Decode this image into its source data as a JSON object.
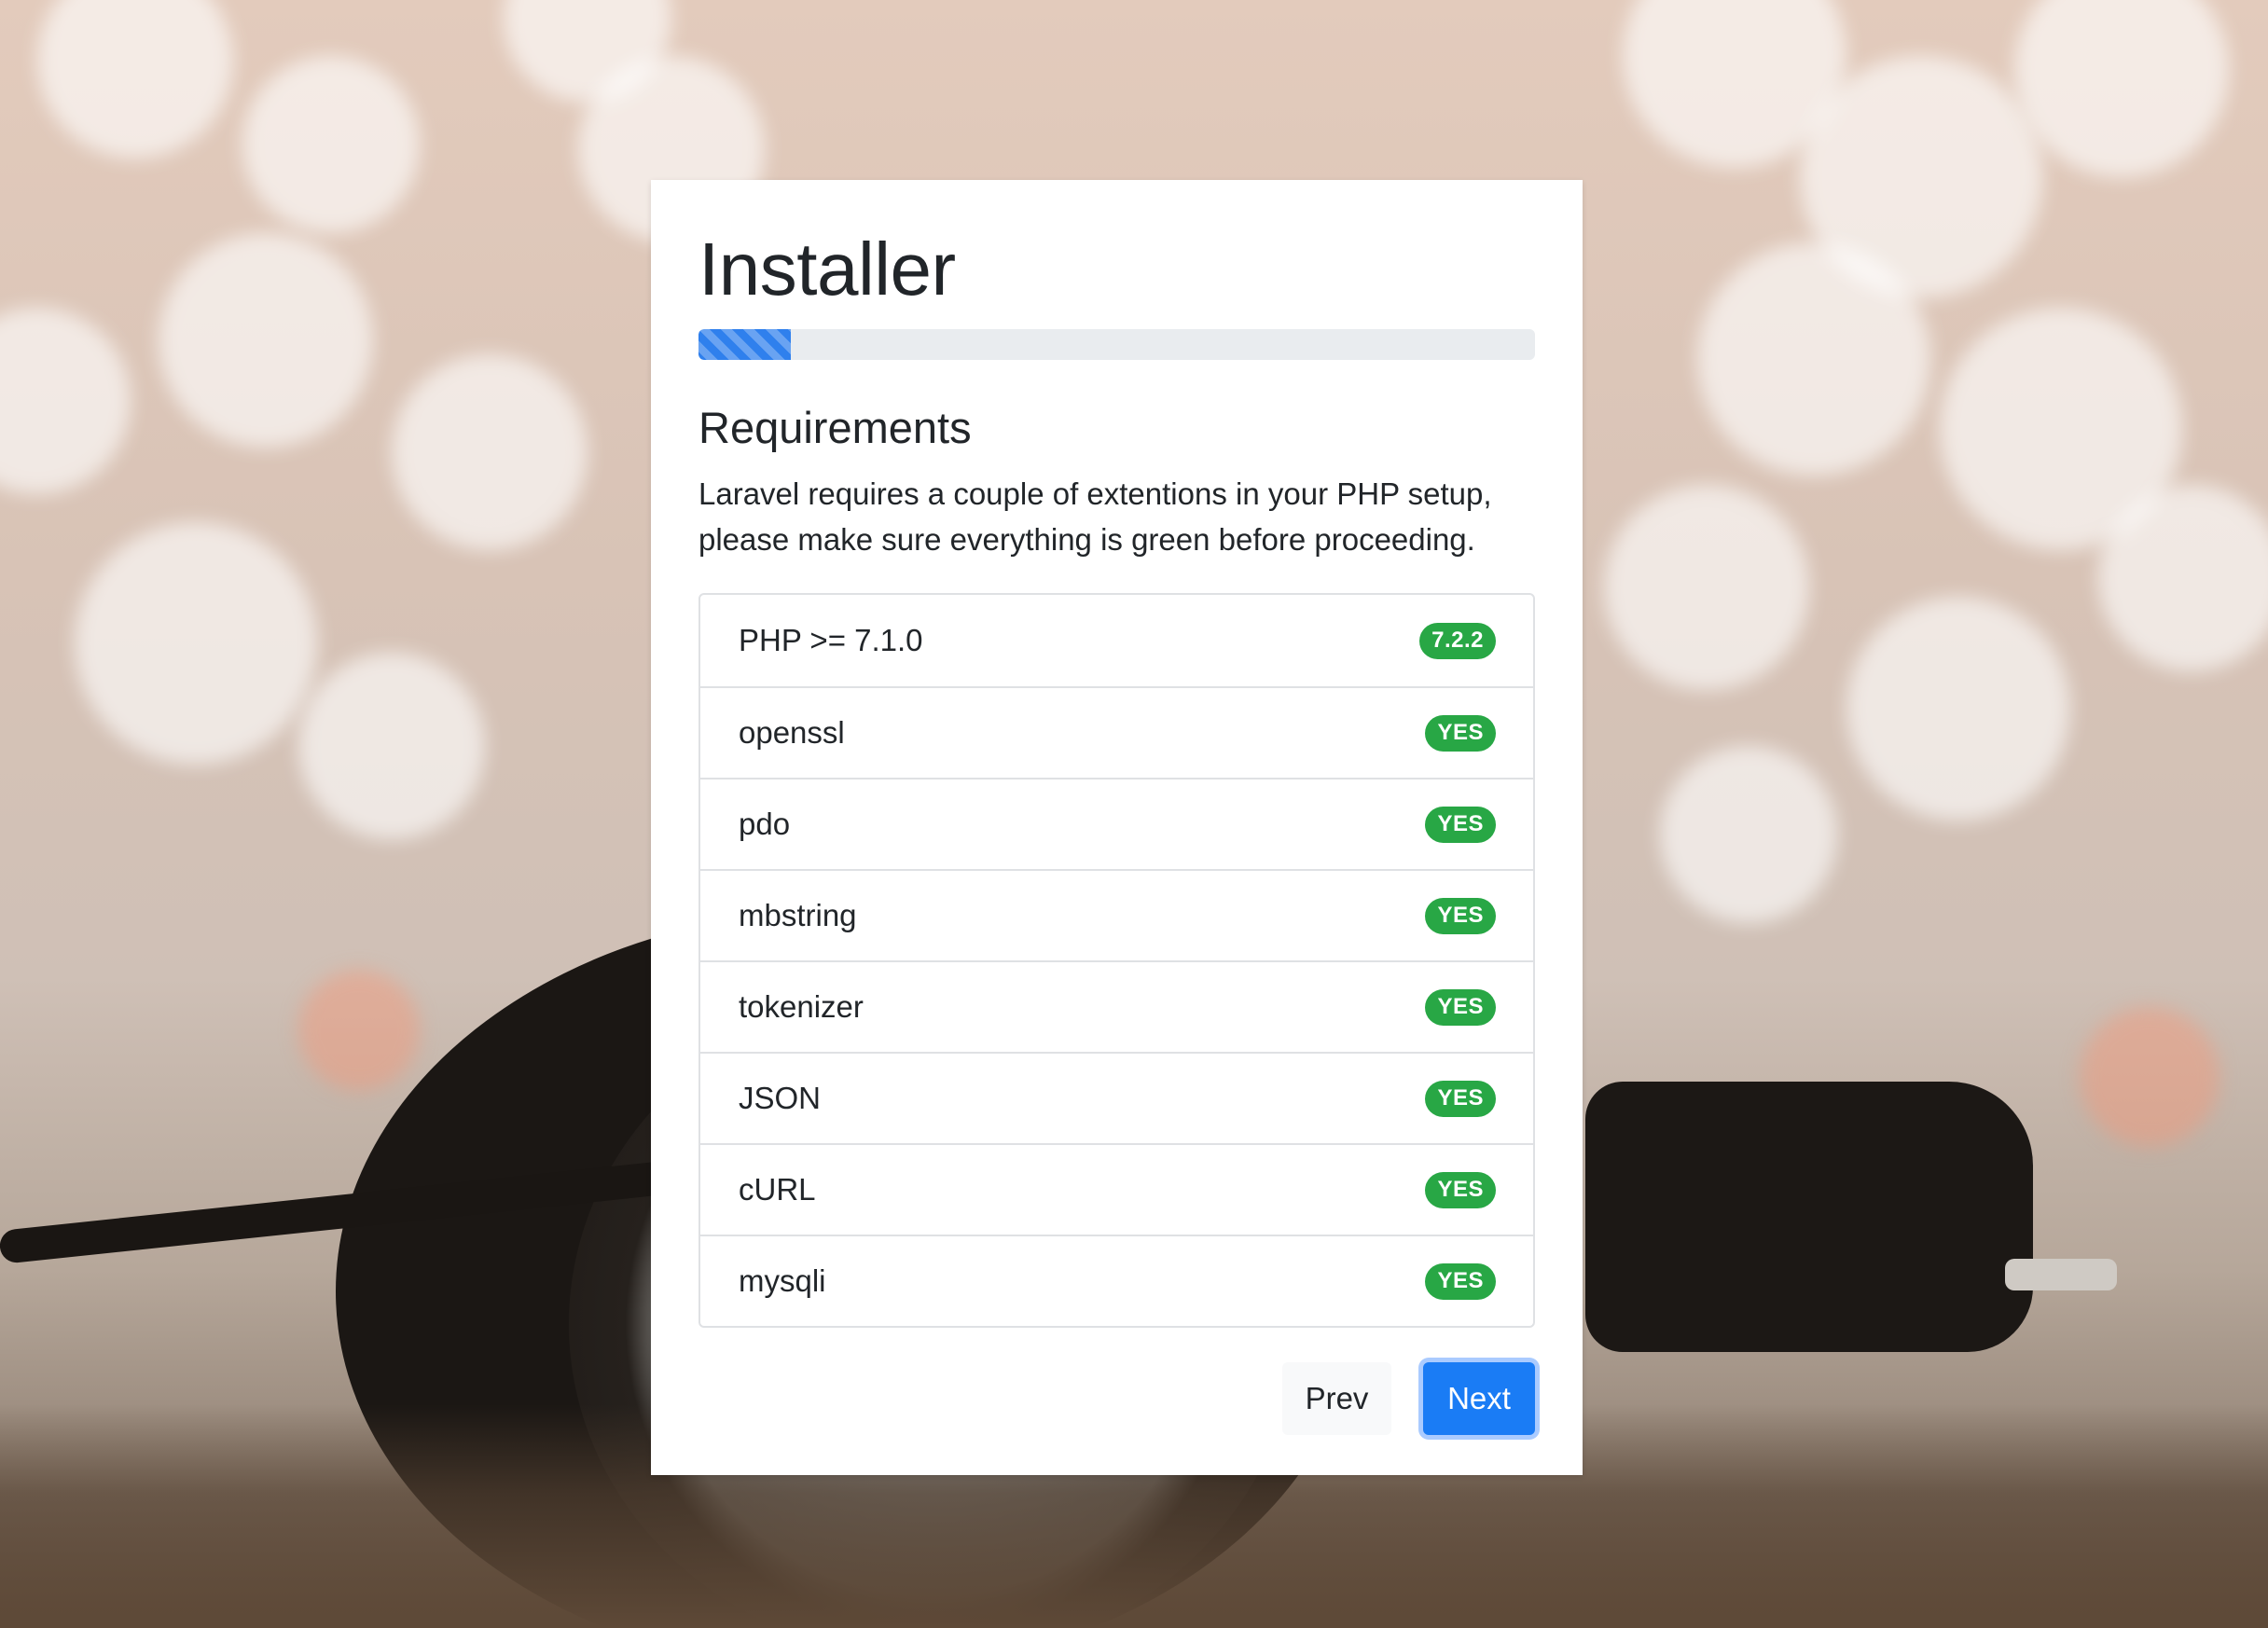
{
  "installer": {
    "title": "Installer",
    "progress_percent": 11
  },
  "requirements": {
    "heading": "Requirements",
    "description": "Laravel requires a couple of extentions in your PHP setup, please make sure everything is green before proceeding.",
    "items": [
      {
        "label": "PHP >= 7.1.0",
        "status": "7.2.2"
      },
      {
        "label": "openssl",
        "status": "YES"
      },
      {
        "label": "pdo",
        "status": "YES"
      },
      {
        "label": "mbstring",
        "status": "YES"
      },
      {
        "label": "tokenizer",
        "status": "YES"
      },
      {
        "label": "JSON",
        "status": "YES"
      },
      {
        "label": "cURL",
        "status": "YES"
      },
      {
        "label": "mysqli",
        "status": "YES"
      }
    ]
  },
  "actions": {
    "prev_label": "Prev",
    "next_label": "Next"
  },
  "colors": {
    "primary": "#1a7cf5",
    "success": "#28a745",
    "progress_track": "#e9ecef"
  }
}
